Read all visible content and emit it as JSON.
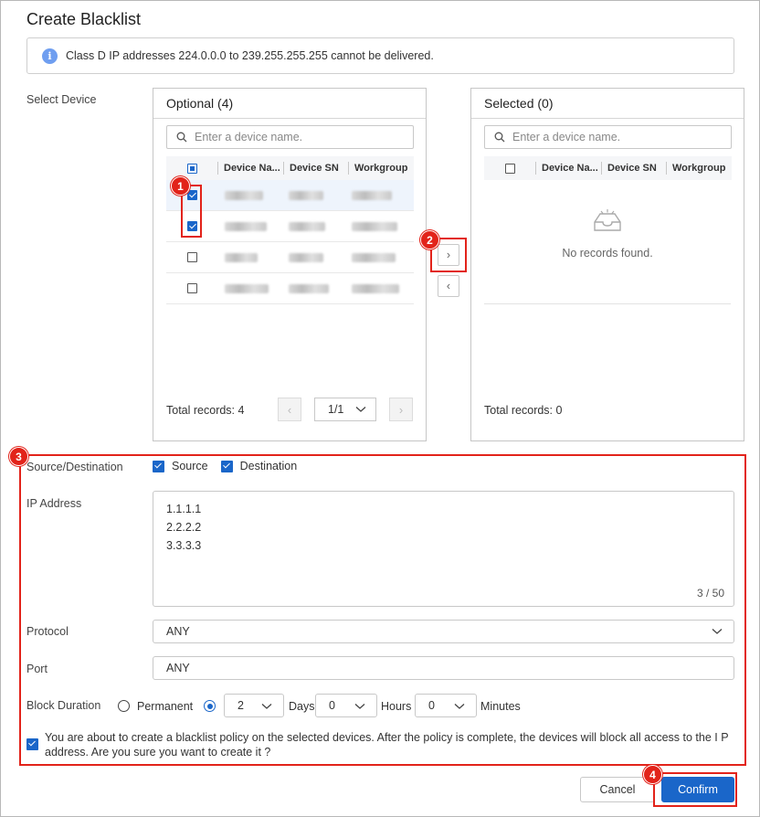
{
  "dialog": {
    "title": "Create Blacklist",
    "notice": "Class D IP addresses 224.0.0.0 to 239.255.255.255 cannot be delivered.",
    "info_icon": "i"
  },
  "select_device": {
    "label": "Select Device",
    "optional": {
      "title": "Optional (4)",
      "search_placeholder": "Enter a device name.",
      "columns": [
        "Device Na...",
        "Device SN",
        "Workgroup"
      ],
      "rows": [
        {
          "checked": true
        },
        {
          "checked": true
        },
        {
          "checked": false
        },
        {
          "checked": false
        }
      ],
      "total": "Total records: 4",
      "page": "1/1",
      "prev": "‹",
      "next": "›"
    },
    "transfer": {
      "right": "›",
      "left": "‹"
    },
    "selected": {
      "title": "Selected (0)",
      "search_placeholder": "Enter a device name.",
      "columns": [
        "Device Na...",
        "Device SN",
        "Workgroup"
      ],
      "empty": "No records found.",
      "total": "Total records: 0"
    }
  },
  "form": {
    "source_destination": {
      "label": "Source/Destination",
      "source": "Source",
      "destination": "Destination"
    },
    "ip_address": {
      "label": "IP Address",
      "lines": [
        "1.1.1.1",
        "2.2.2.2",
        "3.3.3.3"
      ],
      "counter": "3 / 50"
    },
    "protocol": {
      "label": "Protocol",
      "value": "ANY"
    },
    "port": {
      "label": "Port",
      "value": "ANY"
    },
    "block_duration": {
      "label": "Block Duration",
      "permanent": "Permanent",
      "days_value": "2",
      "days_unit": "Days",
      "hours_value": "0",
      "hours_unit": "Hours",
      "minutes_value": "0",
      "minutes_unit": "Minutes"
    },
    "confirm_text": "You are about to create a blacklist policy on the selected devices. After the policy is complete, the devices will block all access to the I P address. Are you sure you want to create it ?"
  },
  "buttons": {
    "cancel": "Cancel",
    "confirm": "Confirm"
  },
  "markers": [
    "1",
    "2",
    "3",
    "4"
  ],
  "colors": {
    "accent": "#1a66c9",
    "marker": "#e2231a"
  }
}
